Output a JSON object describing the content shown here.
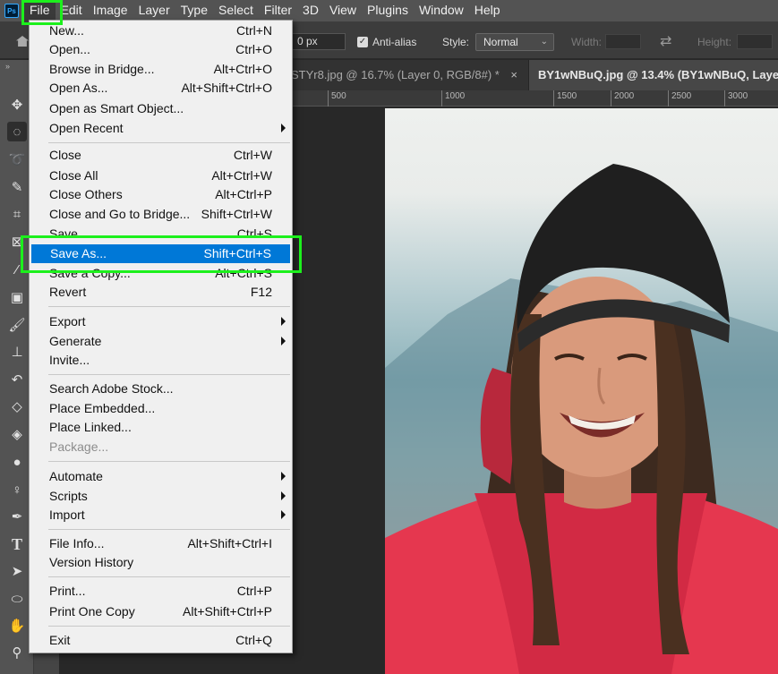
{
  "app": {
    "logo_text": "Ps"
  },
  "menubar": {
    "items": [
      "File",
      "Edit",
      "Image",
      "Layer",
      "Type",
      "Select",
      "Filter",
      "3D",
      "View",
      "Plugins",
      "Window",
      "Help"
    ]
  },
  "options_bar": {
    "feather_value": "0 px",
    "anti_alias_label": "Anti-alias",
    "style_label": "Style:",
    "style_value": "Normal",
    "width_label": "Width:",
    "height_label": "Height:"
  },
  "tabs": [
    {
      "label": "STYr8.jpg @ 16.7% (Layer 0, RGB/8#) *",
      "close": "×"
    },
    {
      "label": "BY1wNBuQ.jpg @ 13.4% (BY1wNBuQ, Layer"
    }
  ],
  "ruler": {
    "ticks": [
      "500",
      "1000",
      "1500",
      "2000",
      "2500",
      "3000"
    ]
  },
  "file_menu": {
    "items": [
      {
        "label": "New...",
        "shortcut": "Ctrl+N"
      },
      {
        "label": "Open...",
        "shortcut": "Ctrl+O"
      },
      {
        "label": "Browse in Bridge...",
        "shortcut": "Alt+Ctrl+O"
      },
      {
        "label": "Open As...",
        "shortcut": "Alt+Shift+Ctrl+O"
      },
      {
        "label": "Open as Smart Object...",
        "shortcut": ""
      },
      {
        "label": "Open Recent",
        "shortcut": "",
        "submenu": true
      },
      {
        "label": "Close",
        "shortcut": "Ctrl+W"
      },
      {
        "label": "Close All",
        "shortcut": "Alt+Ctrl+W"
      },
      {
        "label": "Close Others",
        "shortcut": "Alt+Ctrl+P"
      },
      {
        "label": "Close and Go to Bridge...",
        "shortcut": "Shift+Ctrl+W"
      },
      {
        "label": "Save",
        "shortcut": "Ctrl+S"
      },
      {
        "label": "Save As...",
        "shortcut": "Shift+Ctrl+S",
        "selected": true
      },
      {
        "label": "Save a Copy...",
        "shortcut": "Alt+Ctrl+S"
      },
      {
        "label": "Revert",
        "shortcut": "F12"
      },
      {
        "label": "Export",
        "shortcut": "",
        "submenu": true
      },
      {
        "label": "Generate",
        "shortcut": "",
        "submenu": true
      },
      {
        "label": "Invite...",
        "shortcut": ""
      },
      {
        "label": "Search Adobe Stock...",
        "shortcut": ""
      },
      {
        "label": "Place Embedded...",
        "shortcut": ""
      },
      {
        "label": "Place Linked...",
        "shortcut": ""
      },
      {
        "label": "Package...",
        "shortcut": "",
        "disabled": true
      },
      {
        "label": "Automate",
        "shortcut": "",
        "submenu": true
      },
      {
        "label": "Scripts",
        "shortcut": "",
        "submenu": true
      },
      {
        "label": "Import",
        "shortcut": "",
        "submenu": true
      },
      {
        "label": "File Info...",
        "shortcut": "Alt+Shift+Ctrl+I"
      },
      {
        "label": "Version History",
        "shortcut": ""
      },
      {
        "label": "Print...",
        "shortcut": "Ctrl+P"
      },
      {
        "label": "Print One Copy",
        "shortcut": "Alt+Shift+Ctrl+P"
      },
      {
        "label": "Exit",
        "shortcut": "Ctrl+Q"
      }
    ]
  },
  "toolbar": {
    "tools": [
      "move-icon",
      "elliptical-marquee-icon",
      "lasso-icon",
      "quick-selection-icon",
      "crop-icon",
      "frame-icon",
      "eyedropper-icon",
      "healing-brush-icon",
      "brush-icon",
      "clone-stamp-icon",
      "history-brush-icon",
      "eraser-icon",
      "paint-bucket-icon",
      "blur-icon",
      "dodge-icon",
      "pen-icon",
      "type-icon",
      "path-selection-icon",
      "ellipse-icon",
      "hand-icon",
      "zoom-icon"
    ]
  },
  "colors": {
    "highlight": "#1cf01c",
    "selection": "#0078d7",
    "menubar": "#535353"
  }
}
